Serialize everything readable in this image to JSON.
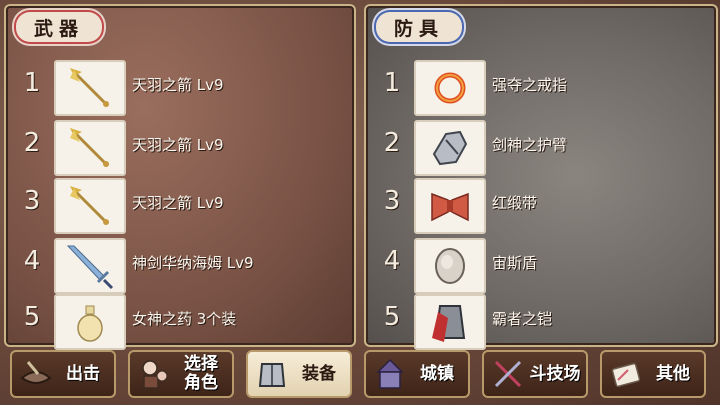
{
  "weapons": {
    "title": "武器",
    "items": [
      {
        "num": "1",
        "name": "天羽之箭 Lv9",
        "icon": "arrow-icon"
      },
      {
        "num": "2",
        "name": "天羽之箭 Lv9",
        "icon": "arrow-icon"
      },
      {
        "num": "3",
        "name": "天羽之箭 Lv9",
        "icon": "arrow-icon"
      },
      {
        "num": "4",
        "name": "神剑华纳海姆 Lv9",
        "icon": "sword-icon"
      },
      {
        "num": "5",
        "name": "女神之药 3个装",
        "icon": "potion-icon"
      }
    ]
  },
  "armor": {
    "title": "防具",
    "items": [
      {
        "num": "1",
        "name": "强夺之戒指",
        "icon": "ring-icon"
      },
      {
        "num": "2",
        "name": "剑神之护臂",
        "icon": "gauntlet-icon"
      },
      {
        "num": "3",
        "name": "红缎带",
        "icon": "ribbon-icon"
      },
      {
        "num": "4",
        "name": "宙斯盾",
        "icon": "shield-icon"
      },
      {
        "num": "5",
        "name": "霸者之铠",
        "icon": "armor-icon"
      }
    ]
  },
  "nav": [
    {
      "label": "出击",
      "icon": "sortie-icon"
    },
    {
      "label": "选择\n角色",
      "icon": "character-icon"
    },
    {
      "label": "装备",
      "icon": "equipment-icon",
      "active": true
    },
    {
      "label": "城镇",
      "icon": "town-icon"
    },
    {
      "label": "斗技场",
      "icon": "arena-icon"
    },
    {
      "label": "其他",
      "icon": "other-icon"
    }
  ]
}
